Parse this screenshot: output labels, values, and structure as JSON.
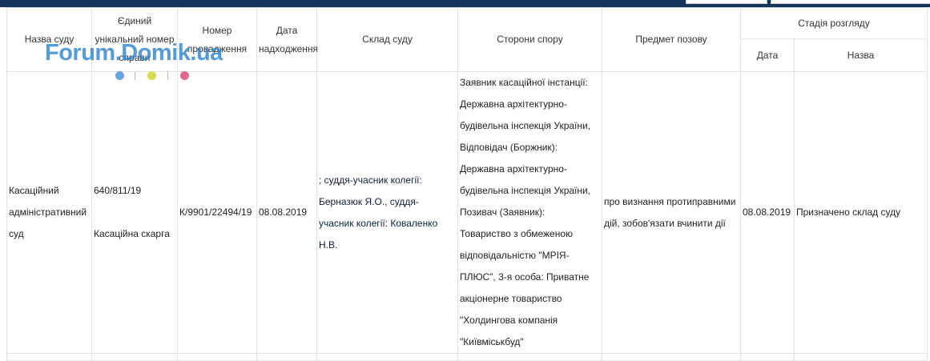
{
  "table": {
    "headers": {
      "court_name": "Назва суду",
      "case_number": "Єдиний\nунікальний номер\nсправи",
      "proceeding_number": "Номер\nпровадження",
      "received_date": "Дата\nнадходження",
      "court_composition": "Склад суду",
      "parties": "Сторони спору",
      "claim_subject": "Предмет позову",
      "stage": "Стадія розгляду",
      "stage_date": "Дата",
      "stage_name": "Назва"
    },
    "rows": [
      {
        "court_name": "Касаційний\nадміністративний\nсуд",
        "case_number": "640/811/19\n\nКасаційна скарга",
        "proceeding_number": "К/9901/22494/19",
        "received_date": "08.08.2019",
        "court_composition": "; суддя-учасник колегії:\nБерназюк Я.О., суддя-\nучасник колегії: Коваленко\nН.В.",
        "parties": "Заявник касаційної інстанції:\nДержавна архітектурно-\nбудівельна інспекція України,\nВідповідач (Боржник):\nДержавна архітектурно-\nбудівельна інспекція України,\nПозивач (Заявник):\nТовариство з обмеженою\nвідповідальністю \"МРІЯ-\nПЛЮС\", 3-я особа: Приватне\nакціонерне товариство\n\"Холдингова компанія\n\"Київміськбуд\"",
        "claim_subject": "про визнання протиправними\nдій, зобов'язати вчинити дії",
        "stage_date": "08.08.2019",
        "stage_name": "Призначено склад суду"
      }
    ]
  },
  "watermark": {
    "text": "Forum.Domik.ua"
  },
  "colors": {
    "topbar": "#13375a",
    "border": "#dfe4ea",
    "watermark": "#2f86cf"
  }
}
